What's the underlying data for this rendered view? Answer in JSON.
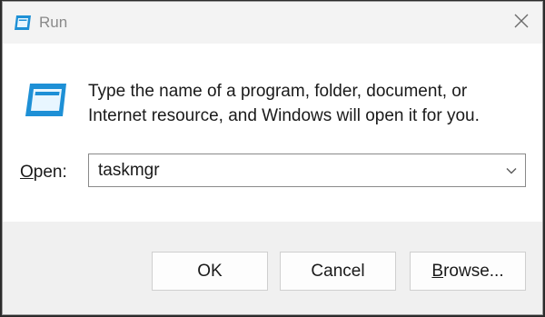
{
  "window": {
    "title": "Run"
  },
  "icons": {
    "title": "run-app-icon",
    "main": "run-app-icon",
    "close": "close-icon",
    "dropdown": "chevron-down-icon"
  },
  "dialog": {
    "description_line1": "Type the name of a program, folder, document, or",
    "description_line2": "Internet resource, and Windows will open it for you.",
    "open_label_prefix": "O",
    "open_label_rest": "pen:",
    "open_value": "taskmgr"
  },
  "buttons": {
    "ok": "OK",
    "cancel": "Cancel",
    "browse_prefix": "B",
    "browse_rest": "rowse..."
  },
  "colors": {
    "accent": "#1e90d6",
    "window_bg": "#f3f3f3",
    "content_bg": "#ffffff"
  }
}
